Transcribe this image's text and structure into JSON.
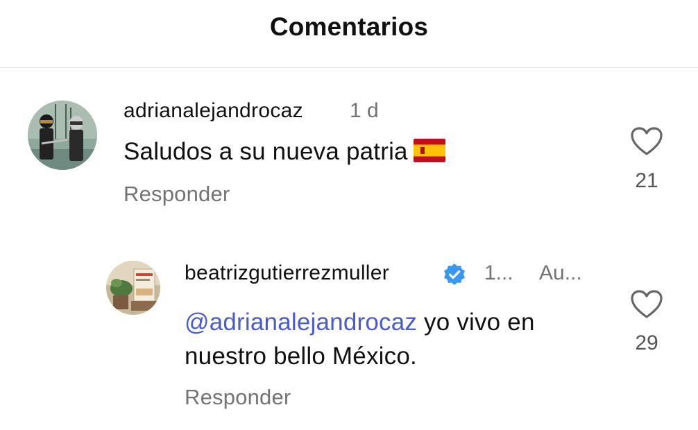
{
  "header": {
    "title": "Comentarios"
  },
  "comments": [
    {
      "username": "adrianalejandrocaz",
      "time": "1 d",
      "text": "Saludos a su nueva patria",
      "emoji": "spain-flag",
      "reply_label": "Responder",
      "likes": "21",
      "avatar": "daft-punk-avatar"
    }
  ],
  "replies": [
    {
      "username": "beatrizgutierrezmuller",
      "verified": true,
      "time": "1...",
      "author_tag": "Au...",
      "mention": "@adrianalejandrocaz",
      "text_line1": " yo vivo en",
      "text_line2": "nuestro bello México.",
      "reply_label": "Responder",
      "likes": "29",
      "avatar": "books-avatar"
    }
  ],
  "colors": {
    "mention": "#4a5bd0",
    "verified": "#3897f0",
    "secondary_text": "#737373"
  }
}
